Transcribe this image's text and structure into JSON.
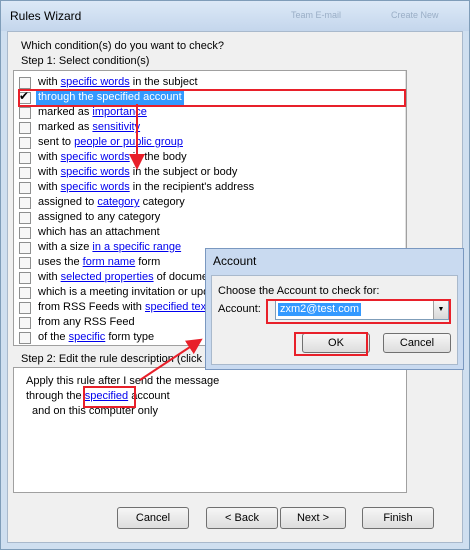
{
  "window": {
    "title": "Rules Wizard",
    "ghost_labels": [
      "Team E-mail",
      "Create New"
    ]
  },
  "step_question": "Which condition(s) do you want to check?",
  "step1_label": "Step 1: Select condition(s)",
  "conditions": [
    {
      "checked": false,
      "selected": false,
      "parts": [
        {
          "t": "with "
        },
        {
          "t": "specific words",
          "link": true
        },
        {
          "t": " in the subject"
        }
      ]
    },
    {
      "checked": true,
      "selected": true,
      "parts": [
        {
          "t": "through the specified account"
        }
      ]
    },
    {
      "checked": false,
      "selected": false,
      "parts": [
        {
          "t": "marked as "
        },
        {
          "t": "importance",
          "link": true
        }
      ]
    },
    {
      "checked": false,
      "selected": false,
      "parts": [
        {
          "t": "marked as "
        },
        {
          "t": "sensitivity",
          "link": true
        }
      ]
    },
    {
      "checked": false,
      "selected": false,
      "parts": [
        {
          "t": "sent to "
        },
        {
          "t": "people or public group",
          "link": true
        }
      ]
    },
    {
      "checked": false,
      "selected": false,
      "parts": [
        {
          "t": "with "
        },
        {
          "t": "specific words",
          "link": true
        },
        {
          "t": " in the body"
        }
      ]
    },
    {
      "checked": false,
      "selected": false,
      "parts": [
        {
          "t": "with "
        },
        {
          "t": "specific words",
          "link": true
        },
        {
          "t": " in the subject or body"
        }
      ]
    },
    {
      "checked": false,
      "selected": false,
      "parts": [
        {
          "t": "with "
        },
        {
          "t": "specific words",
          "link": true
        },
        {
          "t": " in the recipient's address"
        }
      ]
    },
    {
      "checked": false,
      "selected": false,
      "parts": [
        {
          "t": "assigned to "
        },
        {
          "t": "category",
          "link": true
        },
        {
          "t": " category"
        }
      ]
    },
    {
      "checked": false,
      "selected": false,
      "parts": [
        {
          "t": "assigned to any category"
        }
      ]
    },
    {
      "checked": false,
      "selected": false,
      "parts": [
        {
          "t": "which has an attachment"
        }
      ]
    },
    {
      "checked": false,
      "selected": false,
      "parts": [
        {
          "t": "with a size "
        },
        {
          "t": "in a specific range",
          "link": true
        }
      ]
    },
    {
      "checked": false,
      "selected": false,
      "parts": [
        {
          "t": "uses the "
        },
        {
          "t": "form name",
          "link": true
        },
        {
          "t": " form"
        }
      ]
    },
    {
      "checked": false,
      "selected": false,
      "parts": [
        {
          "t": "with "
        },
        {
          "t": "selected properties",
          "link": true
        },
        {
          "t": " of docume"
        }
      ]
    },
    {
      "checked": false,
      "selected": false,
      "parts": [
        {
          "t": "which is a meeting invitation or upd"
        }
      ]
    },
    {
      "checked": false,
      "selected": false,
      "parts": [
        {
          "t": "from RSS Feeds with "
        },
        {
          "t": "specified tex",
          "link": true
        }
      ]
    },
    {
      "checked": false,
      "selected": false,
      "parts": [
        {
          "t": "from any RSS Feed"
        }
      ]
    },
    {
      "checked": false,
      "selected": false,
      "parts": [
        {
          "t": "of the "
        },
        {
          "t": "specific",
          "link": true
        },
        {
          "t": " form type"
        }
      ]
    }
  ],
  "step2_label": "Step 2: Edit the rule description (click a",
  "description": {
    "line1": "Apply this rule after I send the message",
    "line2_prefix": "through the ",
    "line2_link": "specified",
    "line2_suffix": " account",
    "line3": "and on this computer only"
  },
  "buttons": {
    "cancel": "Cancel",
    "back": "< Back",
    "next": "Next >",
    "finish": "Finish"
  },
  "account_dialog": {
    "title": "Account",
    "prompt": "Choose the Account to check for:",
    "field_label": "Account:",
    "selected_value": "zxm2@test.com",
    "ok": "OK",
    "cancel": "Cancel"
  },
  "icons": {
    "scroll_up": "▲",
    "scroll_down": "▼",
    "combo_arrow": "▼"
  },
  "colors": {
    "selection": "#3399ff",
    "annotation": "#e8202a",
    "link": "#0000ee"
  }
}
